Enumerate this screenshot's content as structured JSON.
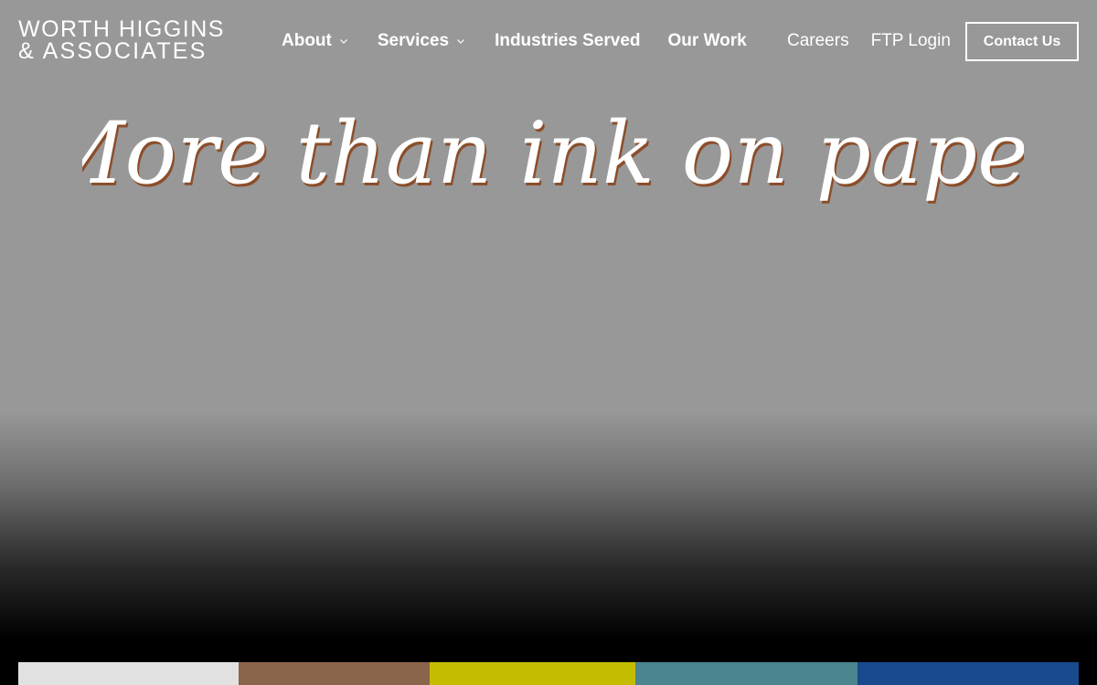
{
  "logo": {
    "line1": "WORTH HIGGINS",
    "line2": "& ASSOCIATES"
  },
  "nav": {
    "about": "About",
    "services": "Services",
    "industries": "Industries Served",
    "our_work": "Our Work"
  },
  "secondary": {
    "careers": "Careers",
    "ftp": "FTP Login"
  },
  "contact_label": "Contact Us",
  "hero": {
    "tagline": "More than ink on paper"
  },
  "colors": {
    "swatches": [
      "#e1e1e1",
      "#8b644c",
      "#c4bc00",
      "#4b858f",
      "#184a8d"
    ],
    "tagline_shadow": "#8b4e2a"
  }
}
